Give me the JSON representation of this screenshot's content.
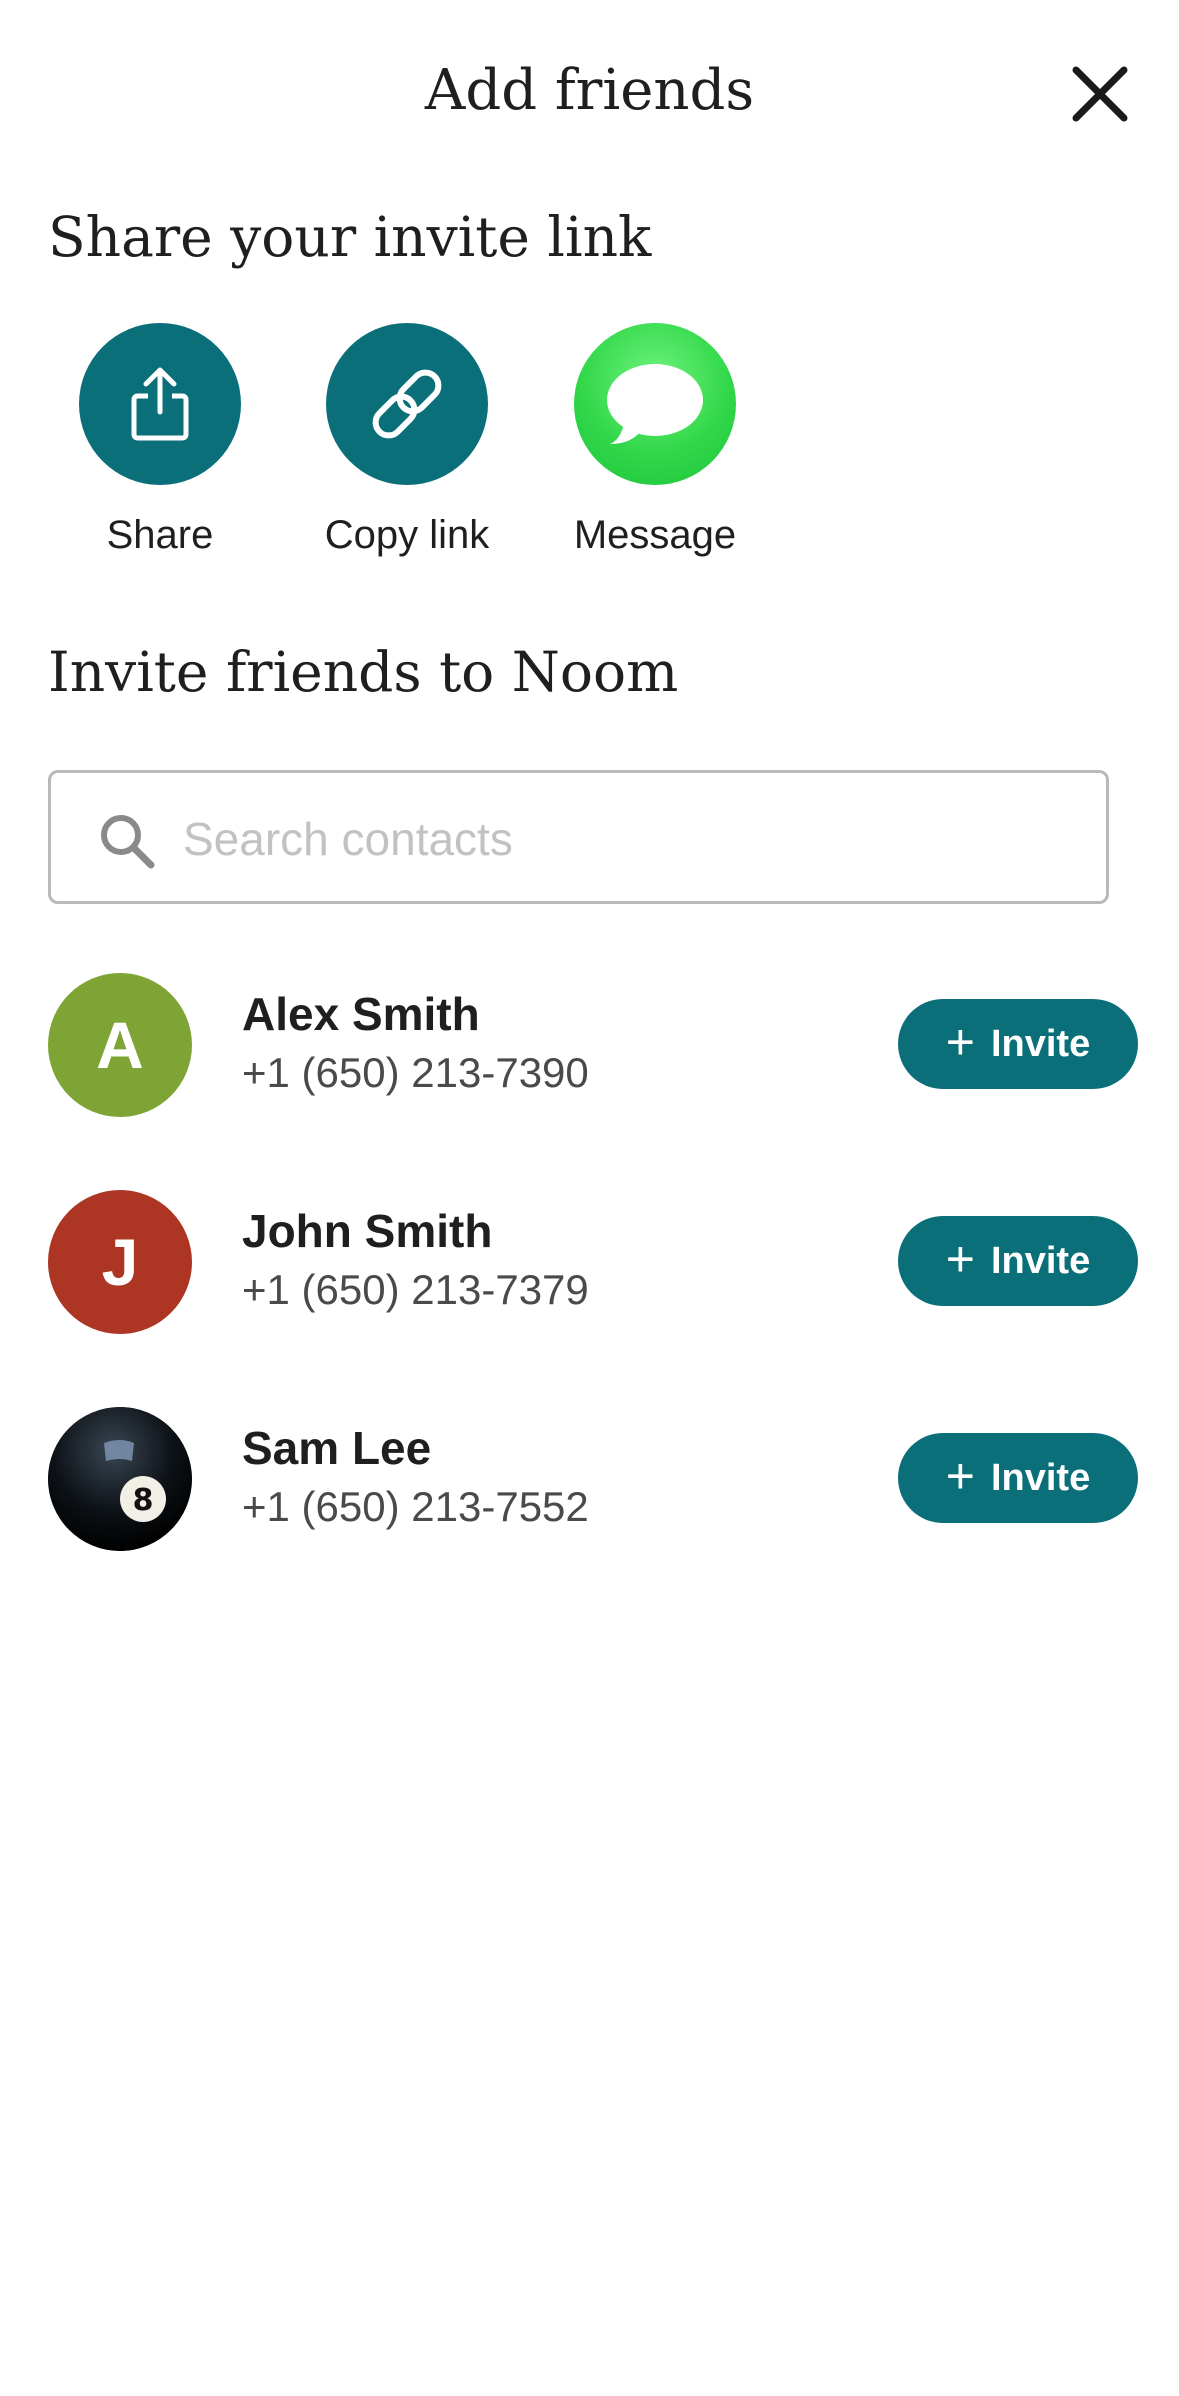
{
  "header": {
    "title": "Add friends",
    "close_icon": "close-icon"
  },
  "share_section": {
    "title": "Share your invite link",
    "options": [
      {
        "label": "Share",
        "icon": "share-icon",
        "color": "#0b6f79"
      },
      {
        "label": "Copy link",
        "icon": "link-icon",
        "color": "#0b6f79"
      },
      {
        "label": "Message",
        "icon": "message-bubble-icon",
        "color": "#34d84b"
      }
    ]
  },
  "invite_section": {
    "title": "Invite friends to Noom",
    "search": {
      "placeholder": "Search contacts",
      "value": ""
    }
  },
  "contacts": [
    {
      "initial": "A",
      "name": "Alex Smith",
      "phone": "+1 (650) 213-7390",
      "avatar_color": "#7fa436",
      "button": "Invite"
    },
    {
      "initial": "J",
      "name": "John Smith",
      "phone": "+1 (650) 213-7379",
      "avatar_color": "#ad3524",
      "button": "Invite"
    },
    {
      "initial": "",
      "name": "Sam Lee",
      "phone": "+1 (650) 213-7552",
      "avatar_icon": "eight-ball-icon",
      "button": "Invite"
    }
  ],
  "colors": {
    "accent": "#0b6f79",
    "message_green": "#34d84b"
  }
}
